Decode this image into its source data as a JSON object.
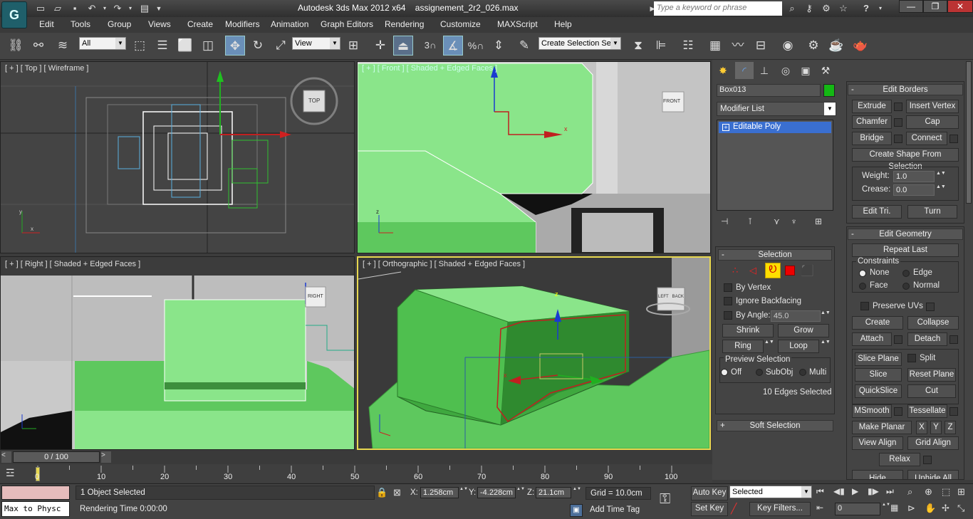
{
  "app": {
    "logo_text": "G",
    "title_app": "Autodesk 3ds Max  2012 x64",
    "title_file": "assignement_2r2_026.max",
    "search_placeholder": "Type a keyword or phrase"
  },
  "menu": [
    "Edit",
    "Tools",
    "Group",
    "Views",
    "Create",
    "Modifiers",
    "Animation",
    "Graph Editors",
    "Rendering",
    "Customize",
    "MAXScript",
    "Help"
  ],
  "toolbar": {
    "filter_value": "All",
    "refcoord_value": "View",
    "selection_set_value": "Create Selection Se",
    "snap_3_label": "3",
    "percent_label": "%"
  },
  "viewports": {
    "top": {
      "label": "[ + ] [ Top ] [ Wireframe ]",
      "cube_label": "TOP"
    },
    "front": {
      "label": "[ + ] [ Front ] [ Shaded + Edged Faces ]",
      "cube_label": "FRONT"
    },
    "right": {
      "label": "[ + ] [ Right ] [ Shaded + Edged Faces ]",
      "cube_label": "RIGHT"
    },
    "ortho": {
      "label": "[ + ] [ Orthographic ] [ Shaded + Edged Faces ]",
      "cube_label": "LEFT   BACK"
    },
    "axis_x": "x",
    "axis_y": "y",
    "axis_z": "z"
  },
  "command_panel": {
    "object_name": "Box013",
    "object_color": "#14b814",
    "modifier_list": "Modifier List",
    "stack_item": "Editable Poly",
    "selection": {
      "header": "Selection",
      "by_vertex": "By Vertex",
      "ignore_backfacing": "Ignore Backfacing",
      "by_angle": "By Angle:",
      "angle_value": "45.0",
      "shrink": "Shrink",
      "grow": "Grow",
      "ring": "Ring",
      "loop": "Loop",
      "preview_selection": "Preview Selection",
      "off": "Off",
      "subobj": "SubObj",
      "multi": "Multi",
      "status": "10 Edges Selected"
    },
    "soft_selection": "Soft Selection",
    "edit_borders": {
      "header": "Edit Borders",
      "extrude": "Extrude",
      "insert_vertex": "Insert Vertex",
      "chamfer": "Chamfer",
      "cap": "Cap",
      "bridge": "Bridge",
      "connect": "Connect",
      "create_shape": "Create Shape From Selection",
      "weight_label": "Weight:",
      "weight_value": "1.0",
      "crease_label": "Crease:",
      "crease_value": "0.0",
      "edit_tri": "Edit Tri.",
      "turn": "Turn"
    },
    "edit_geometry": {
      "header": "Edit Geometry",
      "repeat_last": "Repeat Last",
      "constraints": "Constraints",
      "none": "None",
      "edge": "Edge",
      "face": "Face",
      "normal": "Normal",
      "preserve_uvs": "Preserve UVs",
      "create": "Create",
      "collapse": "Collapse",
      "attach": "Attach",
      "detach": "Detach",
      "slice_plane": "Slice Plane",
      "split": "Split",
      "slice": "Slice",
      "reset_plane": "Reset Plane",
      "quickslice": "QuickSlice",
      "cut": "Cut",
      "msmooth": "MSmooth",
      "tessellate": "Tessellate",
      "make_planar": "Make Planar",
      "x": "X",
      "y": "Y",
      "z": "Z",
      "view_align": "View Align",
      "grid_align": "Grid Align",
      "relax": "Relax",
      "hide_selected": "Hide Selected",
      "unhide_all": "Unhide All"
    }
  },
  "timeline": {
    "slider_text": "0 / 100",
    "ticks": [
      "0",
      "10",
      "20",
      "30",
      "40",
      "50",
      "60",
      "70",
      "80",
      "90",
      "100"
    ]
  },
  "status": {
    "maxscript_text": "Max to Physc",
    "selected_text": "1 Object Selected",
    "prompt_text": "Rendering Time  0:00:00",
    "x_label": "X:",
    "x_value": "1.258cm",
    "y_label": "Y:",
    "y_value": "-4.228cm",
    "z_label": "Z:",
    "z_value": "21.1cm",
    "grid_text": "Grid = 10.0cm",
    "add_time_tag": "Add Time Tag",
    "auto_key": "Auto Key",
    "set_key": "Set Key",
    "selected_dropdown": "Selected",
    "key_filters": "Key Filters...",
    "frame_value": "0"
  }
}
